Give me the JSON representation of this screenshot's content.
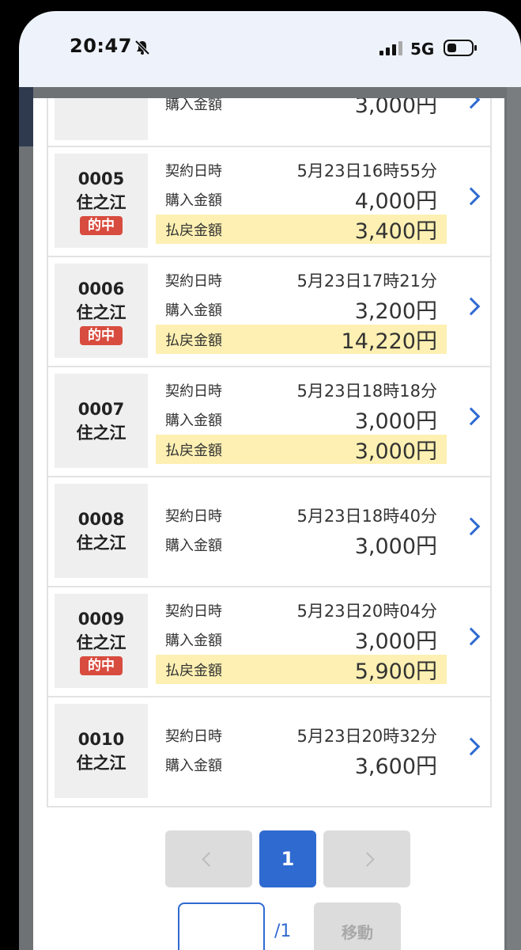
{
  "status_bar": {
    "time": "20:47",
    "network": "5G"
  },
  "labels": {
    "contract_datetime": "契約日時",
    "purchase_amount": "購入金額",
    "payout_amount": "払戻金額",
    "hit": "的中"
  },
  "top_partial": {
    "purchase": "3,000円"
  },
  "rows": [
    {
      "no": "0005",
      "place": "住之江",
      "hit": true,
      "datetime": "5月23日16時55分",
      "purchase": "4,000円",
      "payout": "3,400円"
    },
    {
      "no": "0006",
      "place": "住之江",
      "hit": true,
      "datetime": "5月23日17時21分",
      "purchase": "3,200円",
      "payout": "14,220円"
    },
    {
      "no": "0007",
      "place": "住之江",
      "hit": false,
      "datetime": "5月23日18時18分",
      "purchase": "3,000円",
      "payout": "3,000円"
    },
    {
      "no": "0008",
      "place": "住之江",
      "hit": false,
      "datetime": "5月23日18時40分",
      "purchase": "3,000円",
      "payout": null
    },
    {
      "no": "0009",
      "place": "住之江",
      "hit": true,
      "datetime": "5月23日20時04分",
      "purchase": "3,000円",
      "payout": "5,900円"
    },
    {
      "no": "0010",
      "place": "住之江",
      "hit": false,
      "datetime": "5月23日20時32分",
      "purchase": "3,600円",
      "payout": null
    }
  ],
  "pagination": {
    "current": "1",
    "total": "/1",
    "move_label": "移動"
  },
  "colors": {
    "accent": "#2f6ad1",
    "hit_badge": "#d84c3f",
    "payout_highlight": "#fdf0b2"
  }
}
